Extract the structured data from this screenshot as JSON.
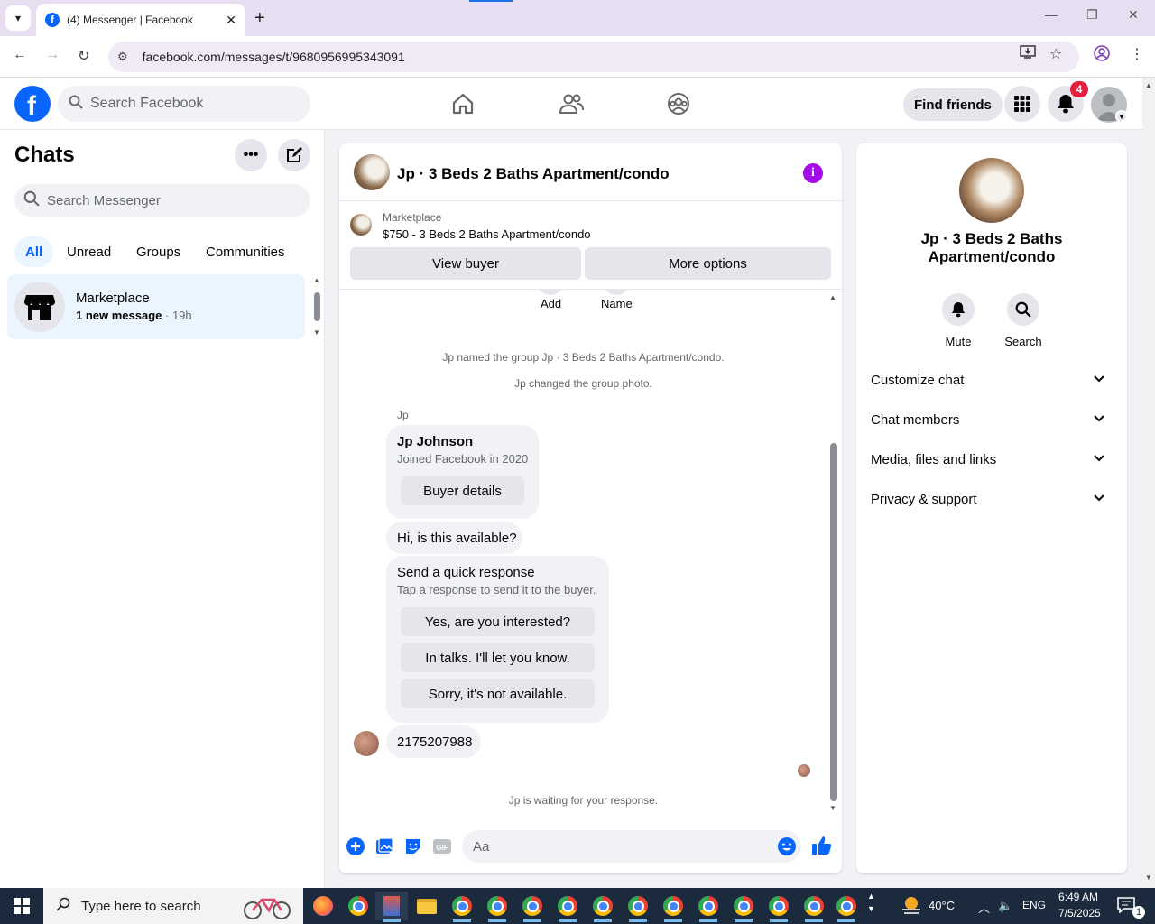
{
  "browser": {
    "tab_title": "(4) Messenger | Facebook",
    "url": "facebook.com/messages/t/9680956995343091"
  },
  "fb_header": {
    "search_placeholder": "Search Facebook",
    "find_friends": "Find friends",
    "notification_count": "4"
  },
  "sidebar": {
    "title": "Chats",
    "search_placeholder": "Search Messenger",
    "filters": [
      "All",
      "Unread",
      "Groups",
      "Communities"
    ],
    "active_filter": "All",
    "chats": [
      {
        "name": "Marketplace",
        "preview": "1 new message",
        "sep": " · ",
        "time": "19h"
      }
    ]
  },
  "conversation": {
    "title": "Jp · 3 Beds 2 Baths Apartment/condo",
    "marketplace_label": "Marketplace",
    "listing": "$750 - 3 Beds 2 Baths Apartment/condo",
    "view_buyer": "View buyer",
    "more_options": "More options",
    "partial_actions": [
      "Add",
      "Name"
    ],
    "system_messages": [
      "Jp named the group Jp · 3 Beds 2 Baths Apartment/condo.",
      "Jp changed the group photo."
    ],
    "sender": "Jp",
    "profile_card": {
      "name": "Jp Johnson",
      "joined": "Joined Facebook in 2020",
      "button": "Buyer details"
    },
    "message_1": "Hi, is this available?",
    "quick_response": {
      "title": "Send a quick response",
      "subtitle": "Tap a response to send it to the buyer.",
      "options": [
        "Yes, are you interested?",
        "In talks. I'll let you know.",
        "Sorry, it's not available."
      ]
    },
    "message_2": "2175207988",
    "waiting": "Jp is waiting for your response.",
    "composer_placeholder": "Aa"
  },
  "info_panel": {
    "name": "Jp · 3 Beds 2 Baths Apartment/condo",
    "actions": [
      "Mute",
      "Search"
    ],
    "sections": [
      "Customize chat",
      "Chat members",
      "Media, files and links",
      "Privacy & support"
    ]
  },
  "taskbar": {
    "search_placeholder": "Type here to search",
    "weather": "40°C",
    "language": "ENG",
    "time": "6:49 AM",
    "date": "7/5/2025",
    "notification_count": "1"
  },
  "colors": {
    "fb_blue": "#0866ff",
    "messenger_purple": "#a30ce8",
    "badge_red": "#e41e3f"
  }
}
